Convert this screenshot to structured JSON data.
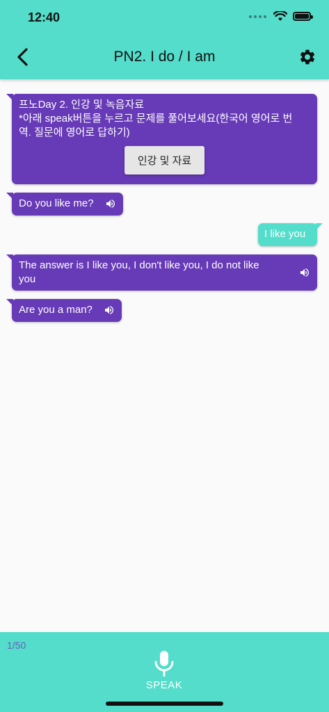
{
  "status_bar": {
    "time": "12:40"
  },
  "header": {
    "title": "PN2. I do / I am"
  },
  "messages": [
    {
      "line1": "프노Day 2. 인강 및 녹음자료",
      "line2": "*아래 speak버튼을 누르고 문제를 풀어보세요(한국어 영어로 번",
      "line3": "역. 질문에 영어로 답하기)",
      "button_label": "인강 및 자료"
    },
    {
      "text": "Do you like me?"
    },
    {
      "text": "I like you"
    },
    {
      "line1": "The answer is I like you, I don't like you, I do not like",
      "line2": "you"
    },
    {
      "text": "Are you a man?"
    }
  ],
  "footer": {
    "counter": "1/50",
    "speak_label": "SPEAK"
  },
  "colors": {
    "teal": "#53ddca",
    "purple": "#673ab7",
    "background": "#fafafa"
  }
}
